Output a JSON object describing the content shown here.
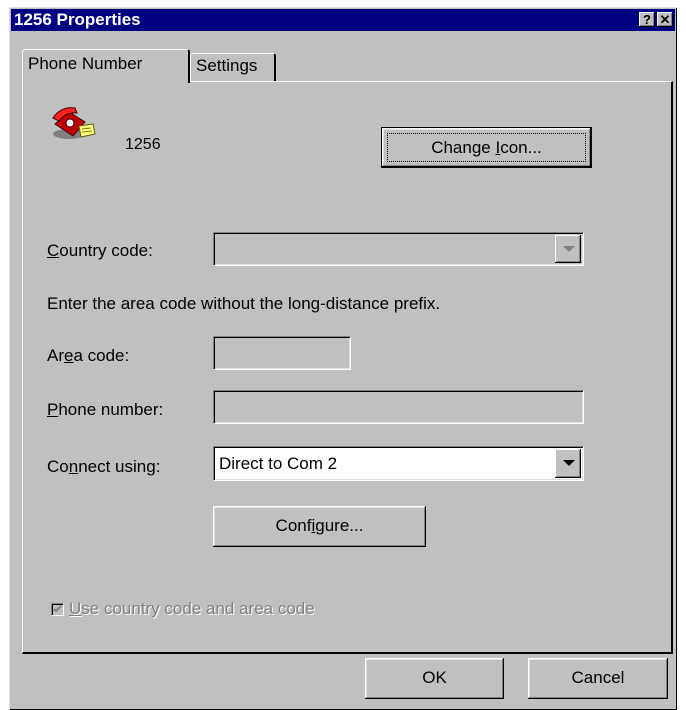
{
  "window": {
    "title": "1256 Properties",
    "help_button": "?",
    "close_button": "✕"
  },
  "tabs": [
    {
      "label": "Phone Number",
      "active": true
    },
    {
      "label": "Settings",
      "active": false
    }
  ],
  "entry": {
    "icon": "telephone-icon",
    "name": "1256",
    "change_icon_prefix": "Change ",
    "change_icon_accel": "I",
    "change_icon_suffix": "con..."
  },
  "country_code": {
    "label_accel": "C",
    "label_rest": "ountry code:",
    "value": ""
  },
  "hint": "Enter the area code without the long-distance prefix.",
  "area_code": {
    "label_pre": "Ar",
    "label_accel": "e",
    "label_post": "a code:",
    "value": ""
  },
  "phone_number": {
    "label_accel": "P",
    "label_rest": "hone number:",
    "value": ""
  },
  "connect_using": {
    "label_pre": "Co",
    "label_accel": "n",
    "label_post": "nect using:",
    "value": "Direct to Com 2"
  },
  "configure": {
    "pre": "Conf",
    "accel": "i",
    "post": "gure..."
  },
  "use_country_code": {
    "accel": "U",
    "rest": "se country code and area code",
    "checked": true
  },
  "footer": {
    "ok": "OK",
    "cancel": "Cancel"
  },
  "colors": {
    "title_bg": "#000080",
    "face": "#c0c0c0",
    "disabled_text": "#808080"
  }
}
